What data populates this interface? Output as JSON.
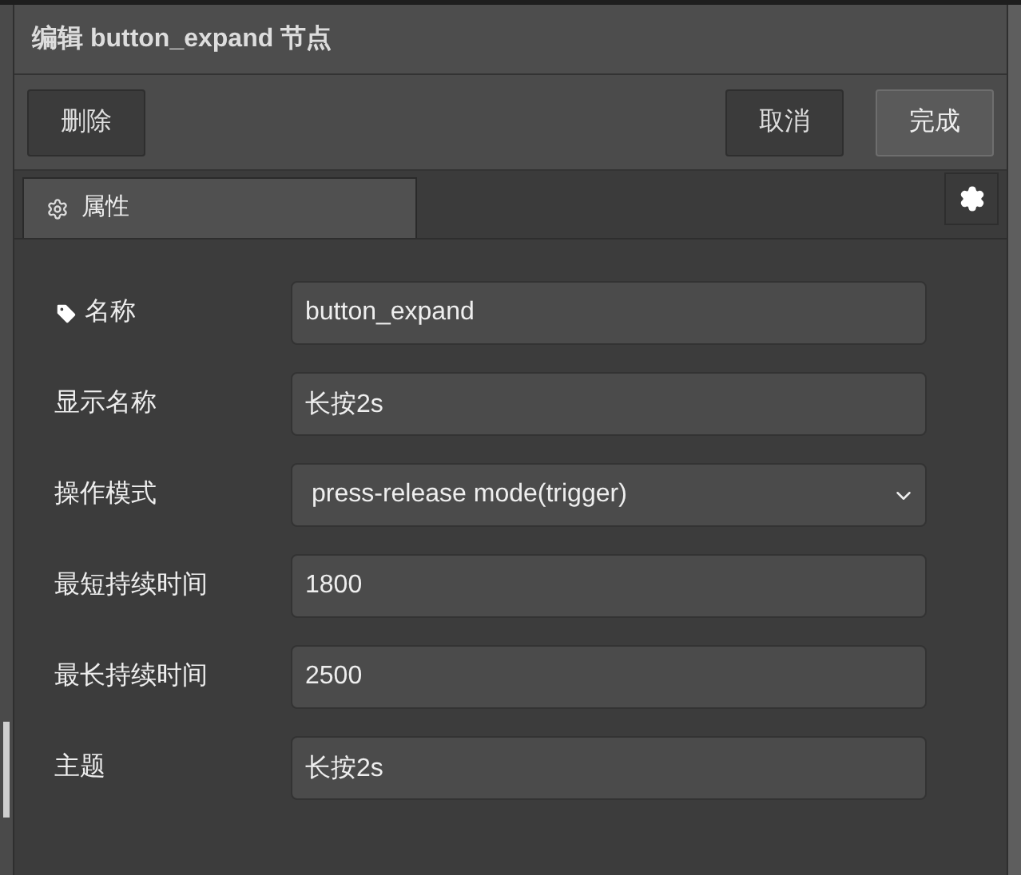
{
  "dialog": {
    "title": "编辑 button_expand 节点"
  },
  "left_buttons": [
    {
      "label": "删除",
      "primary": false
    }
  ],
  "right_buttons": [
    {
      "label": "取消",
      "primary": false
    },
    {
      "label": "完成",
      "primary": true
    }
  ],
  "tabs": [
    {
      "label": "属性",
      "selected": true
    }
  ],
  "fields": [
    {
      "label": "名称",
      "kind": "text",
      "tagged": true,
      "value": "button_expand"
    },
    {
      "label": "显示名称",
      "kind": "text",
      "tagged": false,
      "value": "长按2s"
    },
    {
      "label": "操作模式",
      "kind": "select",
      "tagged": false,
      "value": "press-release mode(trigger)"
    },
    {
      "label": "最短持续时间",
      "kind": "text",
      "tagged": false,
      "value": "1800"
    },
    {
      "label": "最长持续时间",
      "kind": "text",
      "tagged": false,
      "value": "2500"
    },
    {
      "label": "主题",
      "kind": "text",
      "tagged": false,
      "value": "长按2s"
    }
  ]
}
